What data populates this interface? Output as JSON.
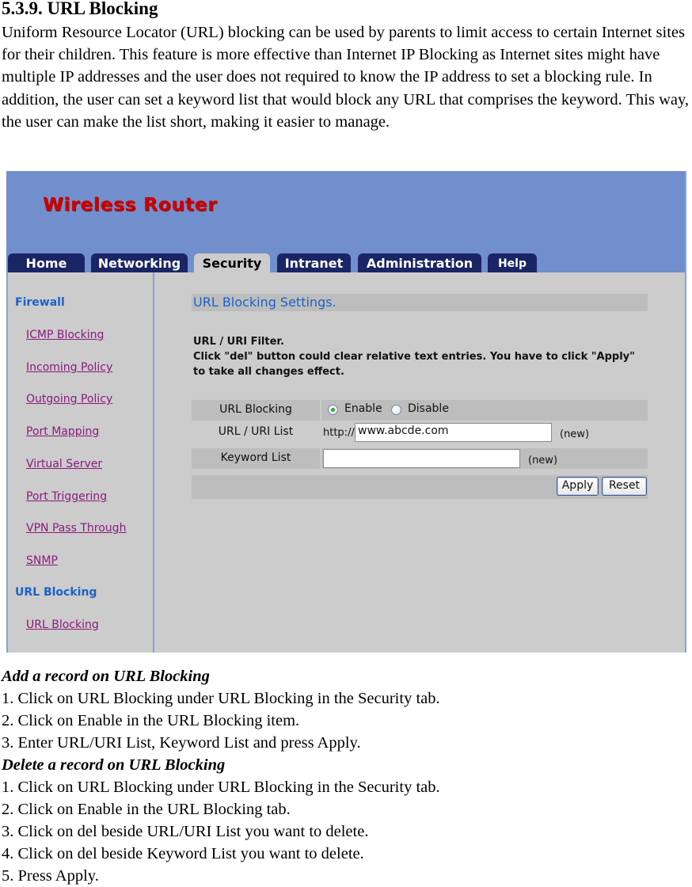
{
  "document": {
    "heading": "5.3.9. URL Blocking",
    "intro": "Uniform Resource Locator (URL) blocking can be used by parents to limit access to certain Internet sites for their children. This feature is more effective than Internet IP Blocking as Internet sites might have multiple IP addresses and the user does not required to know the IP address to set a blocking rule. In addition, the user can set a keyword list that would block any URL that comprises the keyword. This way, the user can make the list short, making it easier to manage."
  },
  "router_ui": {
    "brand": "Wireless Router",
    "tabs": [
      {
        "label": "Home",
        "active": false
      },
      {
        "label": "Networking",
        "active": false
      },
      {
        "label": "Security",
        "active": true
      },
      {
        "label": "Intranet",
        "active": false
      },
      {
        "label": "Administration",
        "active": false
      },
      {
        "label": "Help",
        "active": false
      }
    ],
    "sidebar": {
      "groups": [
        {
          "title": "Firewall",
          "items": [
            "ICMP Blocking",
            "Incoming Policy",
            "Outgoing Policy",
            "Port Mapping",
            "Virtual Server",
            "Port Triggering",
            "VPN Pass Through",
            "SNMP"
          ]
        },
        {
          "title": "URL Blocking",
          "items": [
            "URL Blocking"
          ]
        }
      ]
    },
    "content": {
      "section_title": "URL Blocking Settings.",
      "desc_line1": "URL / URI Filter.",
      "desc_line2": "Click \"del\" button could clear relative text entries. You have to click \"Apply\"",
      "desc_line3": "to take all changes effect.",
      "url_blocking": {
        "label": "URL Blocking",
        "options": [
          "Enable",
          "Disable"
        ],
        "selected": "Enable"
      },
      "url_list": {
        "label": "URL / URI List",
        "prefix": "http://",
        "value": "www.abcde.com",
        "tag": "(new)"
      },
      "keyword_list": {
        "label": "Keyword List",
        "value": "",
        "tag": "(new)"
      },
      "apply_label": "Apply",
      "reset_label": "Reset"
    }
  },
  "instructions": {
    "add_title": "Add a record on URL Blocking",
    "add_steps": [
      "1. Click on URL Blocking under URL Blocking in the Security tab.",
      "2. Click on Enable in the URL Blocking item.",
      "3. Enter URL/URI List, Keyword List and press Apply."
    ],
    "delete_title": "Delete a record on URL Blocking",
    "delete_steps": [
      "1. Click on URL Blocking under URL Blocking in the Security tab.",
      "2. Click on Enable in the URL Blocking tab.",
      "3. Click on del beside URL/URI List you want to delete.",
      "4. Click on del beside Keyword List you want to delete.",
      "5. Press Apply."
    ]
  }
}
